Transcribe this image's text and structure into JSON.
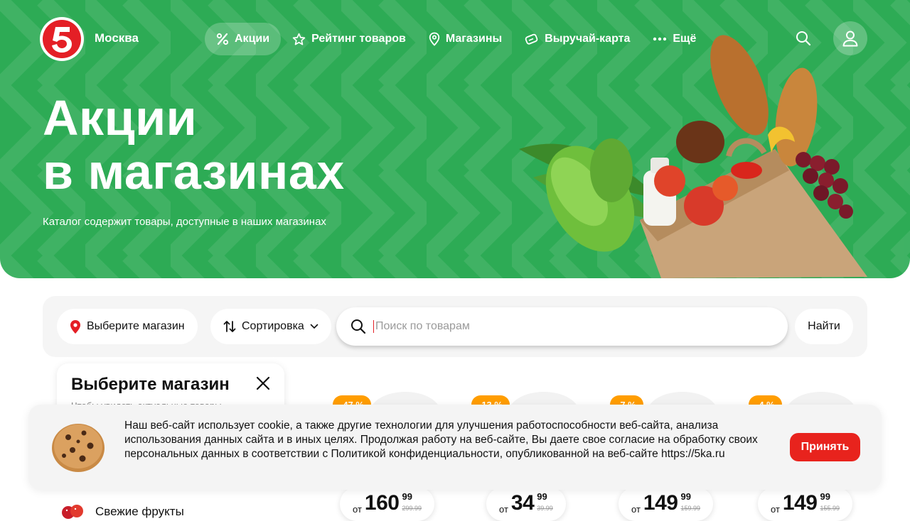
{
  "header": {
    "logo_text": "5",
    "city": "Москва",
    "nav": [
      {
        "label": "Акции",
        "icon": "percent-icon",
        "active": true
      },
      {
        "label": "Рейтинг товаров",
        "icon": "star-icon"
      },
      {
        "label": "Магазины",
        "icon": "map-pin-icon"
      },
      {
        "label": "Выручай-карта",
        "icon": "card-icon"
      },
      {
        "label": "Ещё",
        "icon": "more-dots-icon"
      }
    ]
  },
  "hero": {
    "title_line1": "Акции",
    "title_line2": "в магазинах",
    "subtitle": "Каталог содержит товары, доступные в наших магазинах",
    "image": "grocery-bag"
  },
  "filters": {
    "store_button": "Выберите магазин",
    "sort_button": "Сортировка",
    "search_placeholder": "Поиск по товарам",
    "search_value": "",
    "find_button": "Найти"
  },
  "store_panel": {
    "title": "Выберите магазин",
    "hint": "Чтобы увидеть актуальные товары"
  },
  "products": [
    {
      "discount": "-47 %",
      "from": "от",
      "price": "160",
      "cents": "99",
      "old_price": "299.99"
    },
    {
      "discount": "-13 %",
      "from": "от",
      "price": "34",
      "cents": "99",
      "old_price": "39.99"
    },
    {
      "discount": "-7 %",
      "from": "от",
      "price": "149",
      "cents": "99",
      "old_price": "159.99"
    },
    {
      "discount": "-4 %",
      "from": "от",
      "price": "149",
      "cents": "99",
      "old_price": "155.99"
    }
  ],
  "category": {
    "label": "Свежие фрукты"
  },
  "cookie": {
    "text": "Наш веб-сайт использует cookie, а также другие технологии для улучшения работоспособности веб-сайта, анализа использования данных сайта и в иных целях. Продолжая работу на веб-сайте, Вы даете свое согласие на обработку своих персональных данных в соответствии с Политикой конфиденциальности, опубликованной на веб-сайте https://5ka.ru",
    "accept": "Принять"
  },
  "colors": {
    "brand_green": "#2dab55",
    "brand_red": "#e41f26",
    "discount_orange": "#ff9d00",
    "accept_red": "#e8231d"
  }
}
